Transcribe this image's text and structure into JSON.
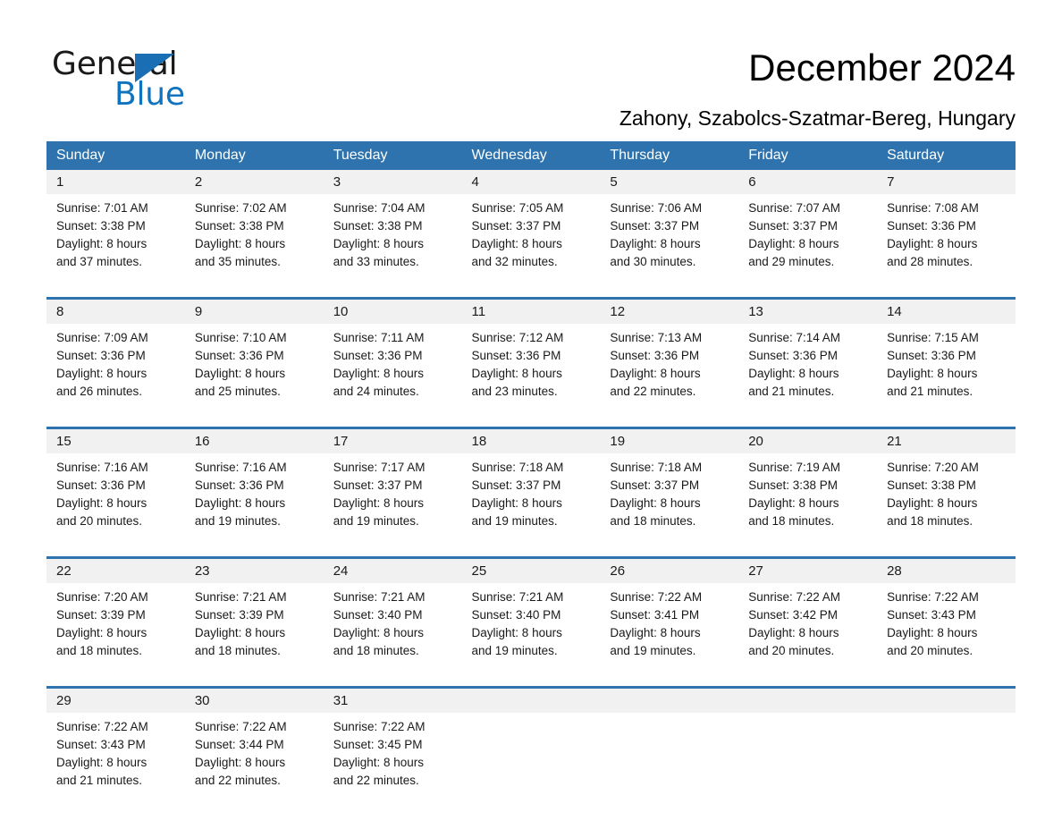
{
  "brand": {
    "name_part1": "General",
    "name_part2": "Blue",
    "triangle_color": "#1a6fb4",
    "blue_color": "#0f74bd"
  },
  "header": {
    "title": "December 2024",
    "subtitle": "Zahony, Szabolcs-Szatmar-Bereg, Hungary"
  },
  "theme": {
    "header_bg": "#2e73ad",
    "daynum_bg": "#f1f1f1",
    "rule_color": "#2e73ad"
  },
  "calendar": {
    "weekdays": [
      "Sunday",
      "Monday",
      "Tuesday",
      "Wednesday",
      "Thursday",
      "Friday",
      "Saturday"
    ],
    "weeks": [
      [
        {
          "day": "1",
          "sunrise": "Sunrise: 7:01 AM",
          "sunset": "Sunset: 3:38 PM",
          "daylight1": "Daylight: 8 hours",
          "daylight2": "and 37 minutes."
        },
        {
          "day": "2",
          "sunrise": "Sunrise: 7:02 AM",
          "sunset": "Sunset: 3:38 PM",
          "daylight1": "Daylight: 8 hours",
          "daylight2": "and 35 minutes."
        },
        {
          "day": "3",
          "sunrise": "Sunrise: 7:04 AM",
          "sunset": "Sunset: 3:38 PM",
          "daylight1": "Daylight: 8 hours",
          "daylight2": "and 33 minutes."
        },
        {
          "day": "4",
          "sunrise": "Sunrise: 7:05 AM",
          "sunset": "Sunset: 3:37 PM",
          "daylight1": "Daylight: 8 hours",
          "daylight2": "and 32 minutes."
        },
        {
          "day": "5",
          "sunrise": "Sunrise: 7:06 AM",
          "sunset": "Sunset: 3:37 PM",
          "daylight1": "Daylight: 8 hours",
          "daylight2": "and 30 minutes."
        },
        {
          "day": "6",
          "sunrise": "Sunrise: 7:07 AM",
          "sunset": "Sunset: 3:37 PM",
          "daylight1": "Daylight: 8 hours",
          "daylight2": "and 29 minutes."
        },
        {
          "day": "7",
          "sunrise": "Sunrise: 7:08 AM",
          "sunset": "Sunset: 3:36 PM",
          "daylight1": "Daylight: 8 hours",
          "daylight2": "and 28 minutes."
        }
      ],
      [
        {
          "day": "8",
          "sunrise": "Sunrise: 7:09 AM",
          "sunset": "Sunset: 3:36 PM",
          "daylight1": "Daylight: 8 hours",
          "daylight2": "and 26 minutes."
        },
        {
          "day": "9",
          "sunrise": "Sunrise: 7:10 AM",
          "sunset": "Sunset: 3:36 PM",
          "daylight1": "Daylight: 8 hours",
          "daylight2": "and 25 minutes."
        },
        {
          "day": "10",
          "sunrise": "Sunrise: 7:11 AM",
          "sunset": "Sunset: 3:36 PM",
          "daylight1": "Daylight: 8 hours",
          "daylight2": "and 24 minutes."
        },
        {
          "day": "11",
          "sunrise": "Sunrise: 7:12 AM",
          "sunset": "Sunset: 3:36 PM",
          "daylight1": "Daylight: 8 hours",
          "daylight2": "and 23 minutes."
        },
        {
          "day": "12",
          "sunrise": "Sunrise: 7:13 AM",
          "sunset": "Sunset: 3:36 PM",
          "daylight1": "Daylight: 8 hours",
          "daylight2": "and 22 minutes."
        },
        {
          "day": "13",
          "sunrise": "Sunrise: 7:14 AM",
          "sunset": "Sunset: 3:36 PM",
          "daylight1": "Daylight: 8 hours",
          "daylight2": "and 21 minutes."
        },
        {
          "day": "14",
          "sunrise": "Sunrise: 7:15 AM",
          "sunset": "Sunset: 3:36 PM",
          "daylight1": "Daylight: 8 hours",
          "daylight2": "and 21 minutes."
        }
      ],
      [
        {
          "day": "15",
          "sunrise": "Sunrise: 7:16 AM",
          "sunset": "Sunset: 3:36 PM",
          "daylight1": "Daylight: 8 hours",
          "daylight2": "and 20 minutes."
        },
        {
          "day": "16",
          "sunrise": "Sunrise: 7:16 AM",
          "sunset": "Sunset: 3:36 PM",
          "daylight1": "Daylight: 8 hours",
          "daylight2": "and 19 minutes."
        },
        {
          "day": "17",
          "sunrise": "Sunrise: 7:17 AM",
          "sunset": "Sunset: 3:37 PM",
          "daylight1": "Daylight: 8 hours",
          "daylight2": "and 19 minutes."
        },
        {
          "day": "18",
          "sunrise": "Sunrise: 7:18 AM",
          "sunset": "Sunset: 3:37 PM",
          "daylight1": "Daylight: 8 hours",
          "daylight2": "and 19 minutes."
        },
        {
          "day": "19",
          "sunrise": "Sunrise: 7:18 AM",
          "sunset": "Sunset: 3:37 PM",
          "daylight1": "Daylight: 8 hours",
          "daylight2": "and 18 minutes."
        },
        {
          "day": "20",
          "sunrise": "Sunrise: 7:19 AM",
          "sunset": "Sunset: 3:38 PM",
          "daylight1": "Daylight: 8 hours",
          "daylight2": "and 18 minutes."
        },
        {
          "day": "21",
          "sunrise": "Sunrise: 7:20 AM",
          "sunset": "Sunset: 3:38 PM",
          "daylight1": "Daylight: 8 hours",
          "daylight2": "and 18 minutes."
        }
      ],
      [
        {
          "day": "22",
          "sunrise": "Sunrise: 7:20 AM",
          "sunset": "Sunset: 3:39 PM",
          "daylight1": "Daylight: 8 hours",
          "daylight2": "and 18 minutes."
        },
        {
          "day": "23",
          "sunrise": "Sunrise: 7:21 AM",
          "sunset": "Sunset: 3:39 PM",
          "daylight1": "Daylight: 8 hours",
          "daylight2": "and 18 minutes."
        },
        {
          "day": "24",
          "sunrise": "Sunrise: 7:21 AM",
          "sunset": "Sunset: 3:40 PM",
          "daylight1": "Daylight: 8 hours",
          "daylight2": "and 18 minutes."
        },
        {
          "day": "25",
          "sunrise": "Sunrise: 7:21 AM",
          "sunset": "Sunset: 3:40 PM",
          "daylight1": "Daylight: 8 hours",
          "daylight2": "and 19 minutes."
        },
        {
          "day": "26",
          "sunrise": "Sunrise: 7:22 AM",
          "sunset": "Sunset: 3:41 PM",
          "daylight1": "Daylight: 8 hours",
          "daylight2": "and 19 minutes."
        },
        {
          "day": "27",
          "sunrise": "Sunrise: 7:22 AM",
          "sunset": "Sunset: 3:42 PM",
          "daylight1": "Daylight: 8 hours",
          "daylight2": "and 20 minutes."
        },
        {
          "day": "28",
          "sunrise": "Sunrise: 7:22 AM",
          "sunset": "Sunset: 3:43 PM",
          "daylight1": "Daylight: 8 hours",
          "daylight2": "and 20 minutes."
        }
      ],
      [
        {
          "day": "29",
          "sunrise": "Sunrise: 7:22 AM",
          "sunset": "Sunset: 3:43 PM",
          "daylight1": "Daylight: 8 hours",
          "daylight2": "and 21 minutes."
        },
        {
          "day": "30",
          "sunrise": "Sunrise: 7:22 AM",
          "sunset": "Sunset: 3:44 PM",
          "daylight1": "Daylight: 8 hours",
          "daylight2": "and 22 minutes."
        },
        {
          "day": "31",
          "sunrise": "Sunrise: 7:22 AM",
          "sunset": "Sunset: 3:45 PM",
          "daylight1": "Daylight: 8 hours",
          "daylight2": "and 22 minutes."
        },
        {
          "day": "",
          "sunrise": "",
          "sunset": "",
          "daylight1": "",
          "daylight2": ""
        },
        {
          "day": "",
          "sunrise": "",
          "sunset": "",
          "daylight1": "",
          "daylight2": ""
        },
        {
          "day": "",
          "sunrise": "",
          "sunset": "",
          "daylight1": "",
          "daylight2": ""
        },
        {
          "day": "",
          "sunrise": "",
          "sunset": "",
          "daylight1": "",
          "daylight2": ""
        }
      ]
    ]
  }
}
